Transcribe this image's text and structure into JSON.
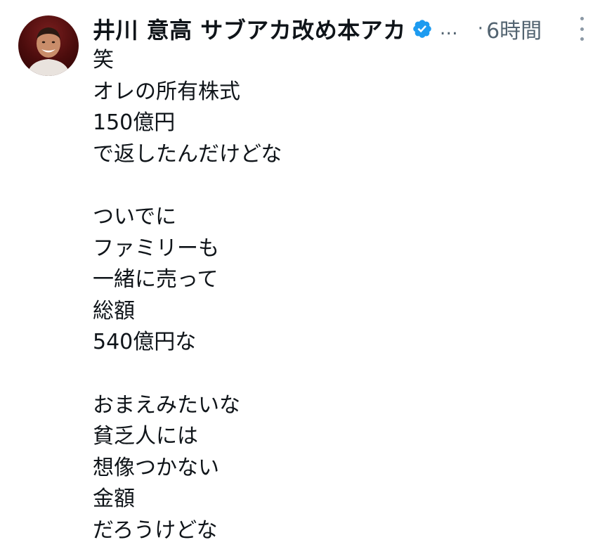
{
  "author": {
    "display_name": "井川 意高 サブアカ改め本アカ",
    "verified": true,
    "truncation": "…",
    "separator": "·",
    "timestamp": "6時間"
  },
  "post": {
    "lines": [
      "笑",
      "オレの所有株式",
      "150億円",
      "で返したんだけどな",
      "",
      "ついでに",
      "ファミリーも",
      "一緒に売って",
      "総額",
      "540億円な",
      "",
      "おまえみたいな",
      "貧乏人には",
      "想像つかない",
      "金額",
      "だろうけどな"
    ]
  },
  "colors": {
    "verified_badge": "#1d9bf0",
    "secondary_text": "#536471",
    "primary_text": "#0f1419"
  },
  "icons": {
    "verified": "verified-badge-icon",
    "more": "more-vertical-icon"
  }
}
